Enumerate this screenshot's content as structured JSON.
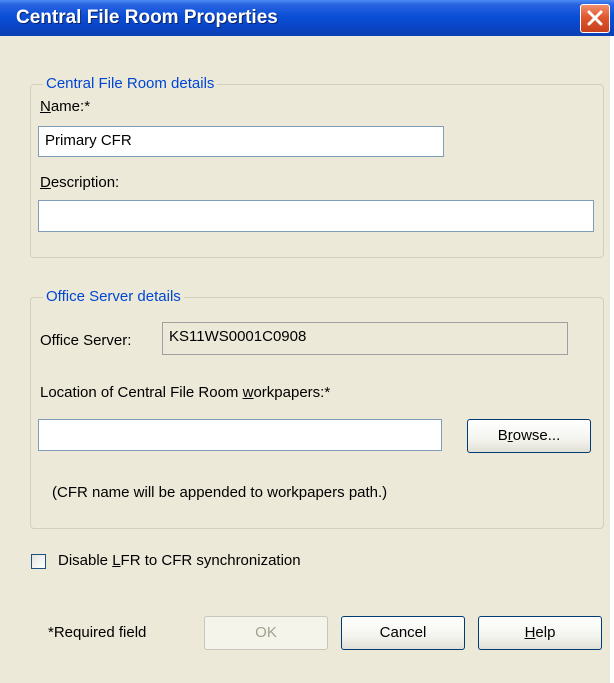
{
  "window": {
    "title": "Central File Room Properties",
    "close_icon": "close-icon"
  },
  "cfr_group": {
    "legend": "Central File Room details",
    "name_label_accel": "N",
    "name_label_rest": "ame:*",
    "name_value": "Primary CFR",
    "description_label_accel": "D",
    "description_label_rest": "escription:",
    "description_value": ""
  },
  "server_group": {
    "legend": "Office Server details",
    "server_label": "Office Server:",
    "server_value": "KS11WS0001C0908",
    "location_label_pre": "Location of Central File Room ",
    "location_label_accel": "w",
    "location_label_post": "orkpapers:*",
    "location_value": "",
    "browse_accel": "r",
    "browse_pre": "B",
    "browse_post": "owse...",
    "note": "(CFR name will be appended to workpapers path.)"
  },
  "sync_checkbox": {
    "label_pre": "Disable ",
    "label_mid": "L",
    "label_accel": "FR to CFR synchronization",
    "checked": false
  },
  "footer": {
    "required_note": "*Required field",
    "ok_label": "OK",
    "cancel_label": "Cancel",
    "help_accel": "H",
    "help_rest": "elp"
  },
  "colors": {
    "title_bar": "#0a4fd8",
    "dialog_bg": "#ece9d8",
    "group_legend": "#0046d5",
    "close_button": "#e0582e"
  }
}
